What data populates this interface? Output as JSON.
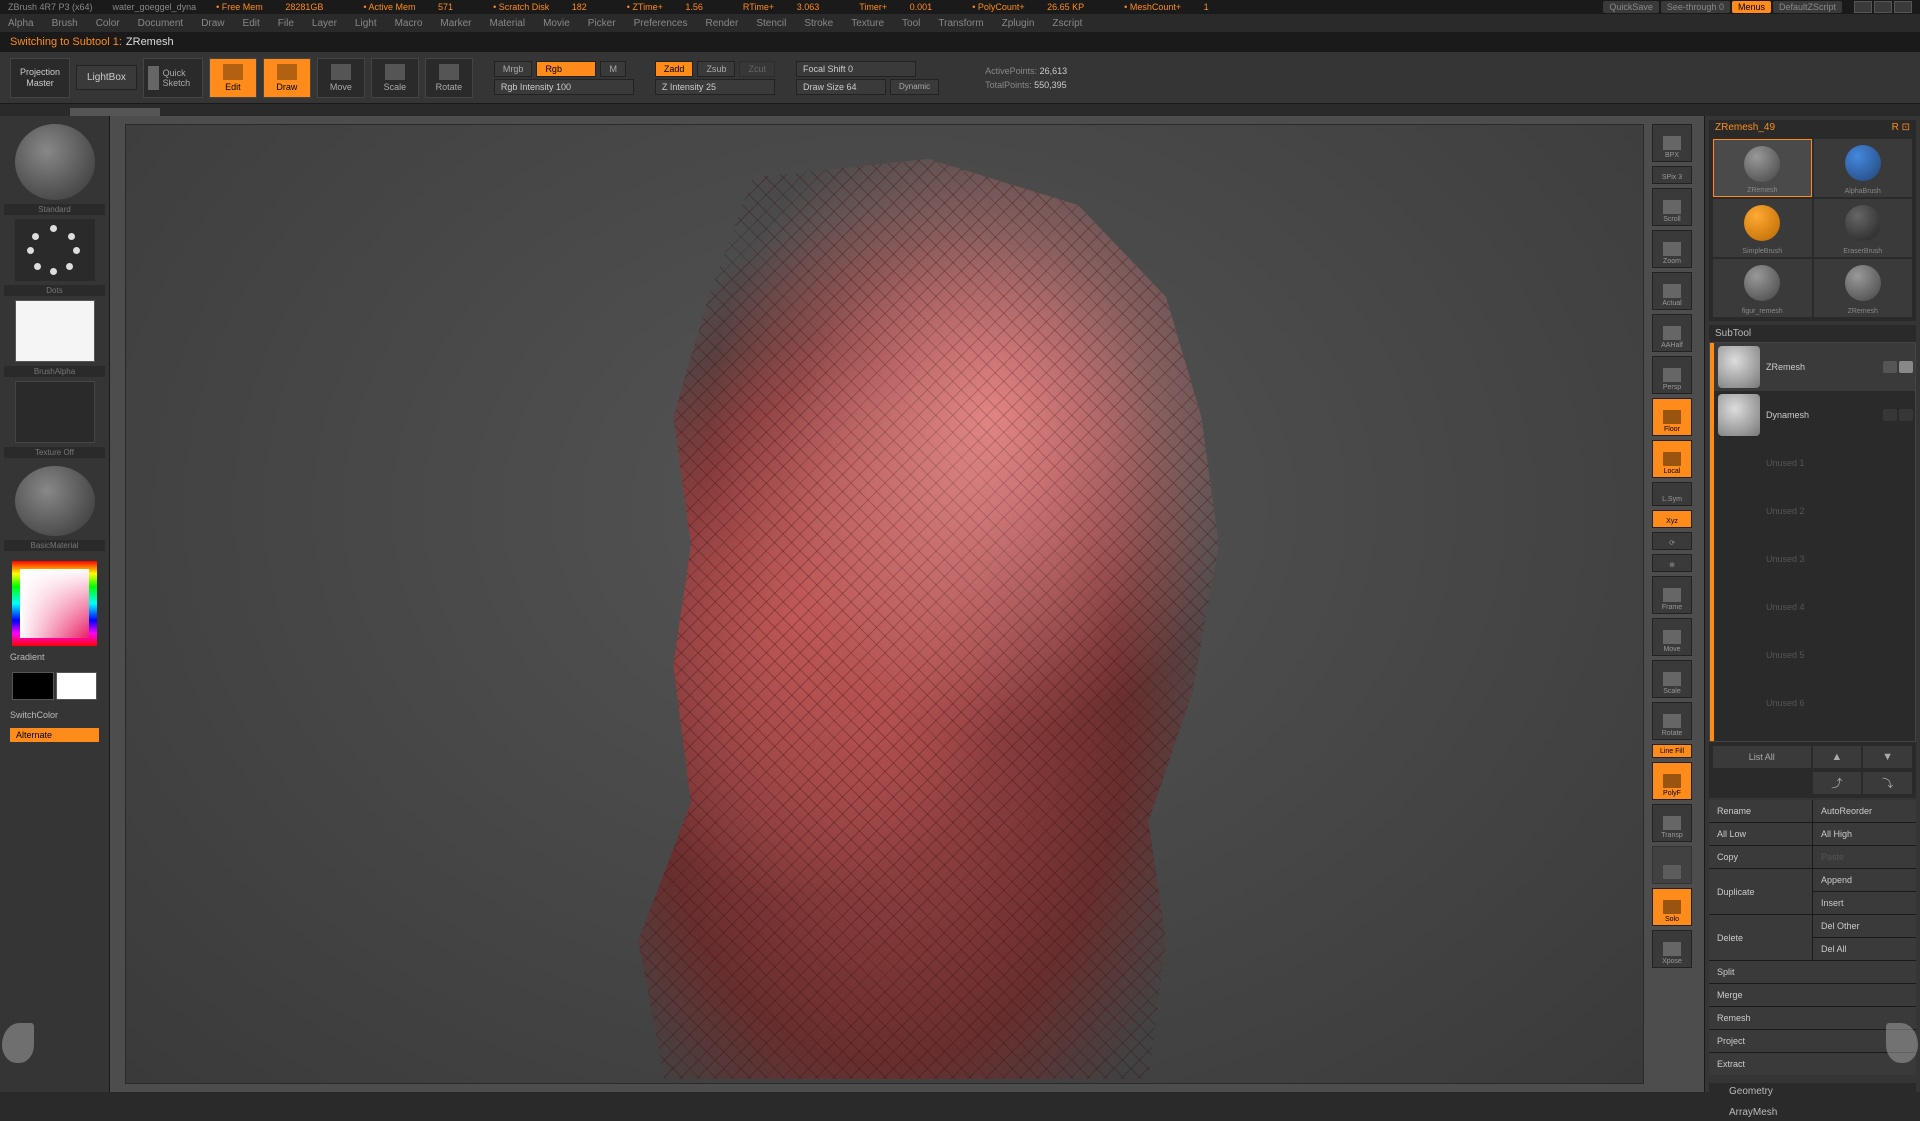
{
  "titlebar": {
    "app": "ZBrush 4R7 P3 (x64)",
    "file": "water_goeggel_dyna",
    "free_mem_label": "Free Mem",
    "free_mem": "28281GB",
    "active_mem_label": "Active Mem",
    "active_mem": "571",
    "scratch_label": "Scratch Disk",
    "scratch": "182",
    "ztime_label": "ZTime+",
    "ztime": "1.56",
    "rtime_label": "RTime+",
    "rtime": "3.063",
    "timer_label": "Timer+",
    "timer": "0.001",
    "poly_label": "PolyCount+",
    "poly": "26.65 KP",
    "mesh_label": "MeshCount+",
    "mesh": "1",
    "quicksave": "QuickSave",
    "seethrough": "See-through   0",
    "menus": "Menus",
    "script": "DefaultZScript"
  },
  "menubar": [
    "Alpha",
    "Brush",
    "Color",
    "Document",
    "Draw",
    "Edit",
    "File",
    "Layer",
    "Light",
    "Macro",
    "Marker",
    "Material",
    "Movie",
    "Picker",
    "Preferences",
    "Render",
    "Stencil",
    "Stroke",
    "Texture",
    "Tool",
    "Transform",
    "Zplugin",
    "Zscript"
  ],
  "status": {
    "switching": "Switching to Subtool 1:",
    "name": "ZRemesh"
  },
  "toolbar": {
    "projection_master": "Projection\nMaster",
    "lightbox": "LightBox",
    "quick_sketch": "Quick\nSketch",
    "edit": "Edit",
    "draw": "Draw",
    "move": "Move",
    "scale": "Scale",
    "rotate": "Rotate",
    "mrgb": "Mrgb",
    "rgb": "Rgb",
    "m": "M",
    "rgb_intensity": "Rgb Intensity 100",
    "zadd": "Zadd",
    "zsub": "Zsub",
    "zcut": "Zcut",
    "z_intensity": "Z Intensity 25",
    "focal_shift": "Focal Shift 0",
    "draw_size": "Draw Size 64",
    "dynamic": "Dynamic",
    "active_label": "ActivePoints:",
    "active": "26,613",
    "total_label": "TotalPoints:",
    "total": "550,395"
  },
  "left": {
    "standard": "Standard",
    "dots": "Dots",
    "brush_alpha": "BrushAlpha",
    "texture_off": "Texture Off",
    "material": "BasicMaterial",
    "gradient": "Gradient",
    "switch": "SwitchColor",
    "alternate": "Alternate"
  },
  "dock": {
    "bpx": "BPX",
    "spix": "SPix 3",
    "scroll": "Scroll",
    "zoom": "Zoom",
    "actual": "Actual",
    "aahalf": "AAHalf",
    "persp": "Persp",
    "floor": "Floor",
    "local": "Local",
    "lsym": "L.Sym",
    "xyz": "Xyz",
    "frame": "Frame",
    "move": "Move",
    "scale": "Scale",
    "rotate": "Rotate",
    "linefill": "Line Fill",
    "polyf": "PolyF",
    "transp": "Transp",
    "solo": "Solo",
    "xpose": "Xpose"
  },
  "right": {
    "header": "ZRemesh_49",
    "tools": [
      "ZRemesh",
      "AlphaBrush",
      "SimpleBrush",
      "EraserBrush",
      "figur_remesh",
      "ZRemesh"
    ],
    "subtool_label": "SubTool",
    "subtools": [
      {
        "name": "ZRemesh"
      },
      {
        "name": "Dynamesh"
      },
      {
        "name": "Unused 1"
      },
      {
        "name": "Unused 2"
      },
      {
        "name": "Unused 3"
      },
      {
        "name": "Unused 4"
      },
      {
        "name": "Unused 5"
      },
      {
        "name": "Unused 6"
      }
    ],
    "list_all": "List All",
    "buttons": {
      "rename": "Rename",
      "autoreorder": "AutoReorder",
      "all_low": "All Low",
      "all_high": "All High",
      "copy": "Copy",
      "paste": "Paste",
      "duplicate": "Duplicate",
      "append": "Append",
      "insert": "Insert",
      "delete": "Delete",
      "del_other": "Del Other",
      "del_all": "Del All",
      "split": "Split",
      "merge": "Merge",
      "remesh": "Remesh",
      "project": "Project",
      "extract": "Extract",
      "geometry": "Geometry",
      "arraymesh": "ArrayMesh"
    }
  }
}
